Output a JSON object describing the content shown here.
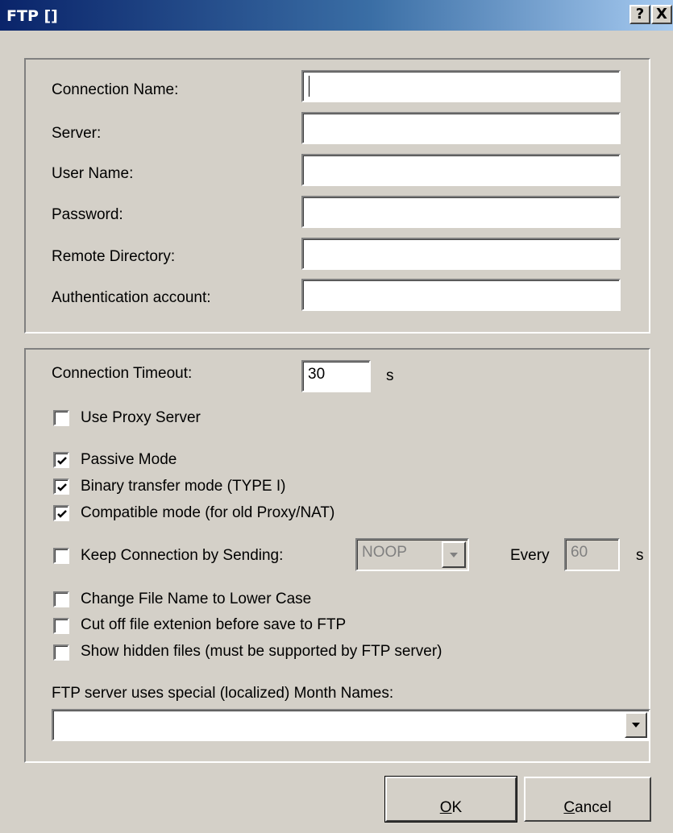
{
  "window": {
    "title": "FTP []",
    "help_glyph": "?",
    "close_glyph": "X"
  },
  "connection": {
    "name_label": "Connection Name:",
    "name_value": "",
    "server_label": "Server:",
    "server_value": "",
    "user_label": "User Name:",
    "user_value": "",
    "password_label": "Password:",
    "password_value": "",
    "remote_dir_label": "Remote Directory:",
    "remote_dir_value": "",
    "auth_label": "Authentication account:",
    "auth_value": ""
  },
  "options": {
    "timeout_label": "Connection Timeout:",
    "timeout_value": "30",
    "timeout_unit": "s",
    "use_proxy": {
      "label": "Use Proxy Server",
      "checked": false
    },
    "passive_mode": {
      "label": "Passive Mode",
      "checked": true
    },
    "binary_mode": {
      "label": "Binary transfer mode (TYPE I)",
      "checked": true
    },
    "compatible_mode": {
      "label": "Compatible mode (for old Proxy/NAT)",
      "checked": true
    },
    "keep_connection": {
      "label": "Keep Connection by Sending:",
      "checked": false,
      "command_value": "NOOP",
      "every_label": "Every",
      "every_value": "60",
      "every_unit": "s"
    },
    "lower_case": {
      "label": "Change File Name to Lower Case",
      "checked": false
    },
    "cut_extension": {
      "label": "Cut off file extenion before save to FTP",
      "checked": false
    },
    "hidden_files": {
      "label": "Show hidden files (must be supported by FTP server)",
      "checked": false
    },
    "month_names_label": "FTP server uses special (localized) Month Names:",
    "month_names_value": ""
  },
  "buttons": {
    "ok_accel": "O",
    "ok_rest": "K",
    "cancel_accel": "C",
    "cancel_rest": "ancel"
  }
}
